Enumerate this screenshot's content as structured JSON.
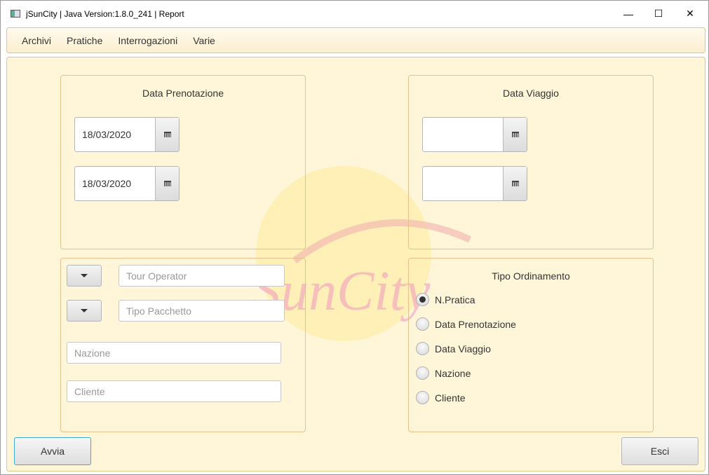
{
  "window": {
    "title": "jSunCity | Java Version:1.8.0_241 | Report",
    "minimize": "—",
    "maximize": "☐",
    "close": "✕"
  },
  "menu": [
    "Archivi",
    "Pratiche",
    "Interrogazioni",
    "Varie"
  ],
  "data_prenotazione": {
    "title": "Data Prenotazione",
    "from": "18/03/2020",
    "to": "18/03/2020"
  },
  "data_viaggio": {
    "title": "Data Viaggio",
    "from": "",
    "to": ""
  },
  "filters": {
    "tour_operator_placeholder": "Tour Operator",
    "tipo_pacchetto_placeholder": "Tipo Pacchetto",
    "nazione_placeholder": "Nazione",
    "cliente_placeholder": "Cliente"
  },
  "ordinamento": {
    "title": "Tipo Ordinamento",
    "options": [
      "N.Pratica",
      "Data Prenotazione",
      "Data Viaggio",
      "Nazione",
      "Cliente"
    ],
    "selected": "N.Pratica"
  },
  "buttons": {
    "avvia": "Avvia",
    "esci": "Esci"
  },
  "watermark": "SunCity"
}
